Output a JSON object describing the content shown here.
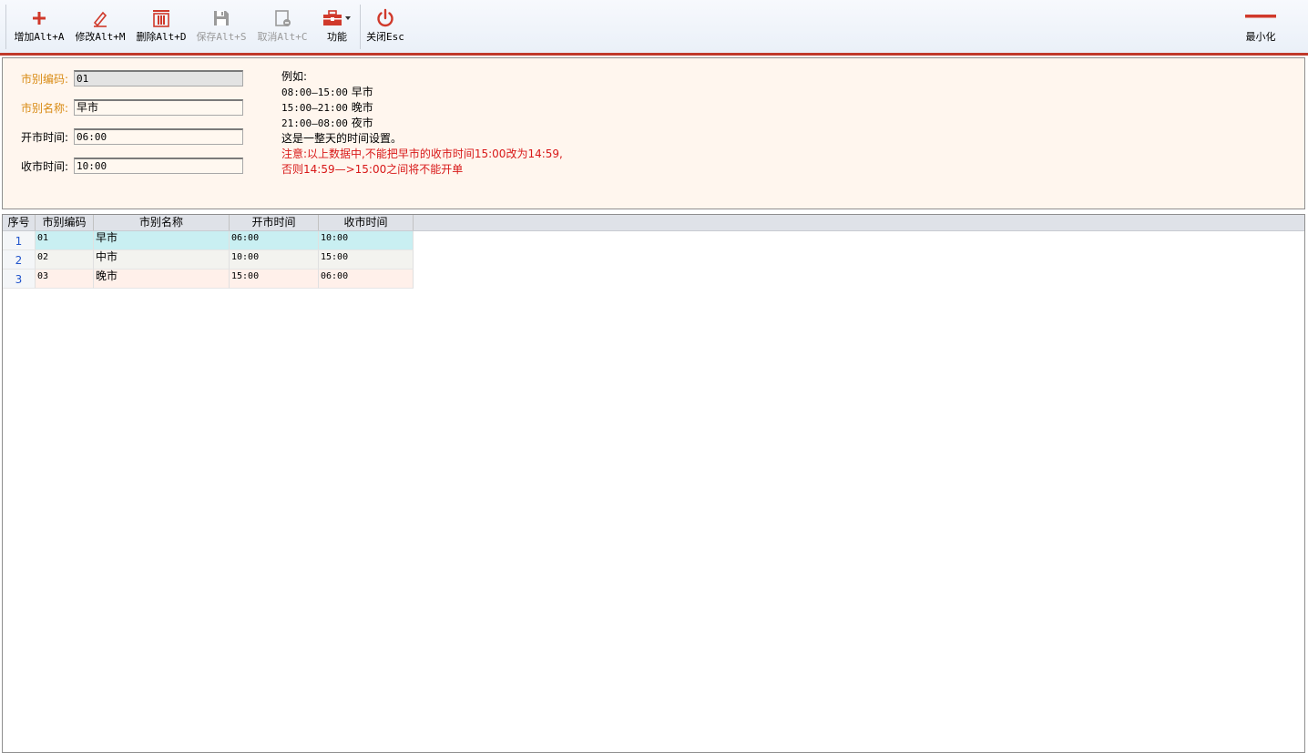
{
  "toolbar": {
    "buttons": [
      {
        "label": "增加Alt+A",
        "icon": "plus-icon",
        "disabled": false
      },
      {
        "label": "修改Alt+M",
        "icon": "pencil-icon",
        "disabled": false
      },
      {
        "label": "删除Alt+D",
        "icon": "trash-icon",
        "disabled": false
      },
      {
        "label": "保存Alt+S",
        "icon": "floppy-disk-icon",
        "disabled": true
      },
      {
        "label": "取消Alt+C",
        "icon": "cancel-document-icon",
        "disabled": true
      },
      {
        "label": "功能",
        "icon": "toolbox-icon",
        "disabled": false
      },
      {
        "label": "关闭Esc",
        "icon": "power-icon",
        "disabled": false
      }
    ],
    "minimize_label": "最小化",
    "accent_color": "#d0392b"
  },
  "form": {
    "code_label": "市别编码:",
    "code_value": "01",
    "name_label": "市别名称:",
    "name_value": "早市",
    "open_label": "开市时间:",
    "open_value": "06:00",
    "close_label": "收市时间:",
    "close_value": "10:00",
    "required_label_color": "#d98b14"
  },
  "notes": {
    "heading": "例如:",
    "example_lines": [
      {
        "time": "08:00—15:00",
        "name": "早市"
      },
      {
        "time": "15:00—21:00",
        "name": "晚市"
      },
      {
        "time": "21:00—08:00",
        "name": "夜市"
      }
    ],
    "summary": "这是一整天的时间设置。",
    "warning_1": "注意:以上数据中,不能把早市的收市时间15:00改为14:59,",
    "warning_2": "否则14:59—>15:00之间将不能开单",
    "warning_color": "#d81818"
  },
  "grid": {
    "headers": [
      "序号",
      "市别编码",
      "市别名称",
      "开市时间",
      "收市时间"
    ],
    "rows": [
      {
        "no": "1",
        "code": "01",
        "name": "早市",
        "open": "06:00",
        "close": "10:00",
        "bg": "#c9eff2"
      },
      {
        "no": "2",
        "code": "02",
        "name": "中市",
        "open": "10:00",
        "close": "15:00",
        "bg": "#f3f3ef"
      },
      {
        "no": "3",
        "code": "03",
        "name": "晚市",
        "open": "15:00",
        "close": "06:00",
        "bg": "#fff0ea"
      }
    ]
  }
}
